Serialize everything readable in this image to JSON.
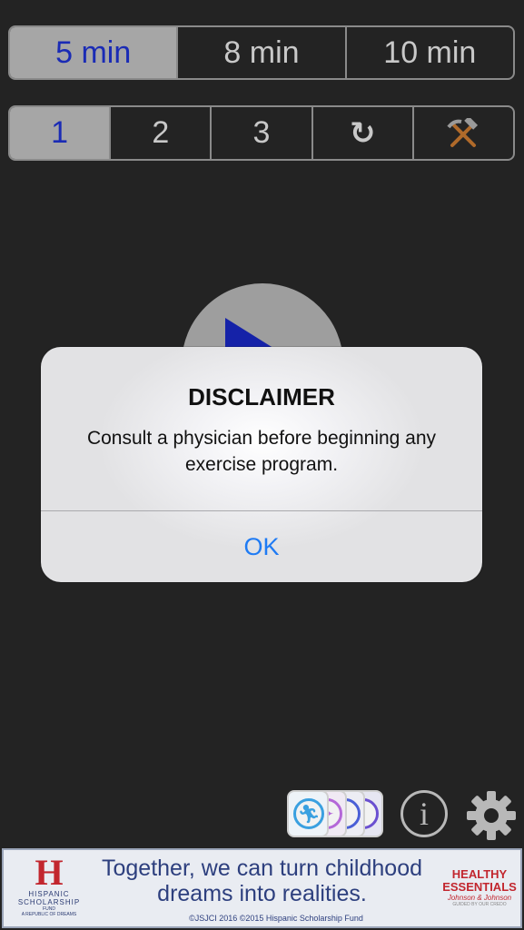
{
  "duration": {
    "options": [
      "5 min",
      "8 min",
      "10 min"
    ],
    "selected": "5 min"
  },
  "round": {
    "options": [
      "1",
      "2",
      "3"
    ],
    "selected": "1",
    "repeat_icon": "↻",
    "tools_icon": "⚒"
  },
  "play": {
    "icon": "play-icon"
  },
  "bottom": {
    "info_glyph": "i",
    "exercise_card_colors": [
      "#3aa0e0",
      "#b468d8",
      "#4a5fd6",
      "#6a4fd0"
    ]
  },
  "ad": {
    "logo_letter": "H",
    "logo_line1": "HISPANIC",
    "logo_line2": "SCHOLARSHIP",
    "logo_line3": "FUND",
    "logo_line4": "A REPUBLIC OF DREAMS",
    "headline_line1": "Together, we can turn childhood",
    "headline_line2": "dreams into realities.",
    "copyright": "©JSJCI 2016 ©2015 Hispanic Scholarship Fund",
    "brand_line1": "HEALTHY",
    "brand_line2": "ESSENTIALS",
    "brand_line3": "Johnson & Johnson",
    "brand_line4": "GUIDED BY OUR CREDO"
  },
  "alert": {
    "title": "DISCLAIMER",
    "message": "Consult a physician before beginning any exercise program.",
    "ok_label": "OK"
  },
  "colors": {
    "active_segment_bg": "#a6a6a6",
    "active_segment_text": "#1a2bb5",
    "ok_blue": "#1f7bf4",
    "ad_red": "#c2262e",
    "ad_navy": "#2d3f7e"
  }
}
